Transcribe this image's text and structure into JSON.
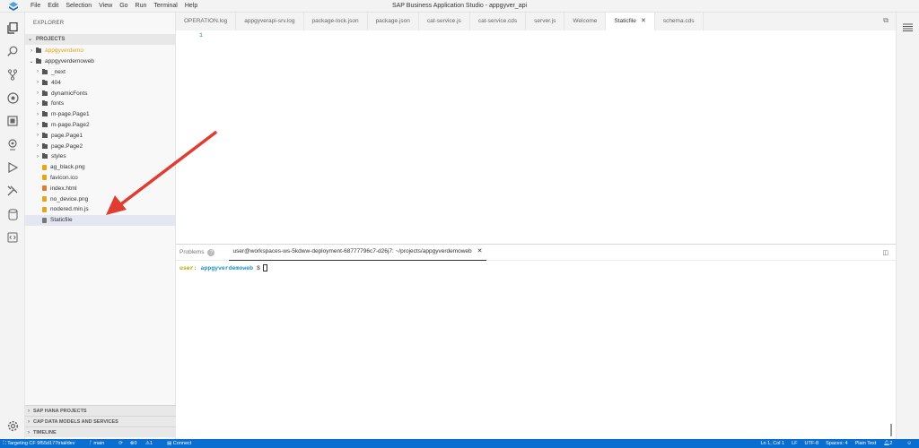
{
  "menubar": {
    "items": [
      "File",
      "Edit",
      "Selection",
      "View",
      "Go",
      "Run",
      "Terminal",
      "Help"
    ],
    "window_title": "SAP Business Application Studio - appgyver_api"
  },
  "activity_icons": [
    "explorer-icon",
    "search-icon",
    "source-control-icon",
    "debug-icon",
    "extensions-icon",
    "location-icon",
    "run-icon",
    "tools-icon",
    "database-icon",
    "code-icon",
    "settings-icon"
  ],
  "sidebar": {
    "title": "EXPLORER",
    "projects_header": "PROJECTS",
    "tree": [
      {
        "label": "appgyverdemo",
        "type": "folder",
        "depth": 0,
        "chevron": "›",
        "color": "#e8a317"
      },
      {
        "label": "appgyverdemoweb",
        "type": "folder",
        "depth": 0,
        "chevron": "⌄",
        "color": "#333333"
      },
      {
        "label": "_next",
        "type": "folder",
        "depth": 1,
        "chevron": "›"
      },
      {
        "label": "404",
        "type": "folder",
        "depth": 1,
        "chevron": "›"
      },
      {
        "label": "dynamicFonts",
        "type": "folder",
        "depth": 1,
        "chevron": "›"
      },
      {
        "label": "fonts",
        "type": "folder",
        "depth": 1,
        "chevron": "›"
      },
      {
        "label": "m-page.Page1",
        "type": "folder",
        "depth": 1,
        "chevron": "›"
      },
      {
        "label": "m-page.Page2",
        "type": "folder",
        "depth": 1,
        "chevron": "›"
      },
      {
        "label": "page.Page1",
        "type": "folder",
        "depth": 1,
        "chevron": "›"
      },
      {
        "label": "page.Page2",
        "type": "folder",
        "depth": 1,
        "chevron": "›"
      },
      {
        "label": "styles",
        "type": "folder",
        "depth": 1,
        "chevron": "›"
      },
      {
        "label": "ag_black.png",
        "type": "file",
        "depth": 1,
        "icon_color": "#e8a317"
      },
      {
        "label": "favicon.ico",
        "type": "file",
        "depth": 1,
        "icon_color": "#e8a317"
      },
      {
        "label": "index.html",
        "type": "file",
        "depth": 1,
        "icon_color": "#e37933"
      },
      {
        "label": "no_device.png",
        "type": "file",
        "depth": 1,
        "icon_color": "#e8a317"
      },
      {
        "label": "nodered.min.js",
        "type": "file",
        "depth": 1,
        "icon_color": "#e8a317"
      },
      {
        "label": "Staticfile",
        "type": "file",
        "depth": 1,
        "icon_color": "#777777",
        "selected": true
      }
    ],
    "bottom_sections": [
      "SAP HANA PROJECTS",
      "CAP DATA MODELS AND SERVICES",
      "TIMELINE"
    ]
  },
  "tabs": [
    {
      "label": "OPERATION.log",
      "active": false
    },
    {
      "label": "appgyverapi-srv.log",
      "active": false
    },
    {
      "label": "package-lock.json",
      "active": false
    },
    {
      "label": "package.json",
      "active": false
    },
    {
      "label": "cat-service.js",
      "active": false
    },
    {
      "label": "cat-service.cds",
      "active": false
    },
    {
      "label": "server.js",
      "active": false
    },
    {
      "label": "Welcome",
      "active": false
    },
    {
      "label": "Staticfile",
      "active": true
    },
    {
      "label": "schema.cds",
      "active": false
    }
  ],
  "editor": {
    "line_number": "1"
  },
  "panel": {
    "problems_label": "Problems",
    "terminal_tab": "user@workspaces-ws-5kdww-deployment-68777796c7-d26j7: ~/projects/appgyverdemoweb",
    "prompt_user": "user:",
    "prompt_dir": "appgyverdemoweb",
    "prompt_symbol": "$"
  },
  "statusbar": {
    "targeting": "Targeting CF 9f55d177trial/dev",
    "branch": "main",
    "errors": "0",
    "warnings": "1",
    "connect": "Connect",
    "position": "Ln 1, Col 1",
    "eol": "LF",
    "encoding": "UTF-8",
    "spaces": "Spaces: 4",
    "language": "Plain Text",
    "notifications": "2"
  },
  "colors": {
    "accent": "#0a6ed1",
    "highlight": "#e8a317",
    "arrow": "#e03c31",
    "prompt_user": "#b5a30b",
    "prompt_dir": "#1d8ec2"
  }
}
